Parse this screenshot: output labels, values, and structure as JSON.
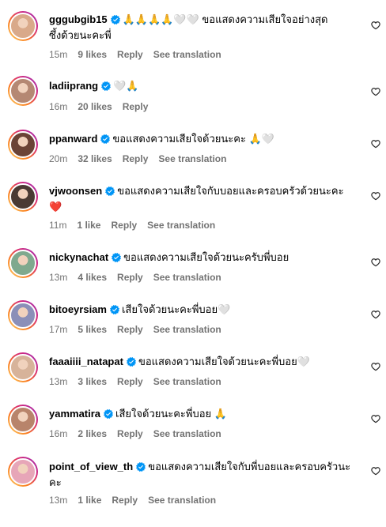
{
  "comments": [
    {
      "username": "gggubgib15",
      "text_line1": "🙏🙏🙏🙏🤍🤍 ขอแสดงความเสียใจอย่างสุด",
      "text_line2": "ซึ้งด้วยนะคะพี่",
      "time": "15m",
      "likes": "9 likes",
      "reply": "Reply",
      "translate": "See translation",
      "avatar_color": "#d9a98a"
    },
    {
      "username": "ladiiprang",
      "text_line1": "🤍🙏",
      "time": "16m",
      "likes": "20 likes",
      "reply": "Reply",
      "avatar_color": "#b58873"
    },
    {
      "username": "ppanward",
      "text_line1": "ขอแสดงความเสียใจด้วยนะคะ 🙏🤍",
      "time": "20m",
      "likes": "32 likes",
      "reply": "Reply",
      "translate": "See translation",
      "avatar_color": "#6b4336"
    },
    {
      "username": "vjwoonsen",
      "text_line1": "ขอแสดงความเสียใจกับบอยและครอบครัวด้วยนะคะ",
      "text_line2": "❤️",
      "time": "11m",
      "likes": "1 like",
      "reply": "Reply",
      "translate": "See translation",
      "avatar_color": "#4a3a33"
    },
    {
      "username": "nickynachat",
      "text_line1": "ขอแสดงความเสียใจด้วยนะครับพี่บอย",
      "time": "13m",
      "likes": "4 likes",
      "reply": "Reply",
      "translate": "See translation",
      "avatar_color": "#7fa98e"
    },
    {
      "username": "bitoeyrsiam",
      "text_line1": "เสียใจด้วยนะคะพี่บอย🤍",
      "time": "17m",
      "likes": "5 likes",
      "reply": "Reply",
      "translate": "See translation",
      "avatar_color": "#8b8fb8"
    },
    {
      "username": "faaaiiii_natapat",
      "text_line1": "ขอแสดงความเสียใจด้วยนะคะพี่บอย🤍",
      "time": "13m",
      "likes": "3 likes",
      "reply": "Reply",
      "translate": "See translation",
      "avatar_color": "#d7b39a"
    },
    {
      "username": "yammatira",
      "text_line1": "เสียใจด้วยนะคะพี่บอย 🙏",
      "time": "16m",
      "likes": "2 likes",
      "reply": "Reply",
      "translate": "See translation",
      "avatar_color": "#b8846b"
    },
    {
      "username": "point_of_view_th",
      "text_line1": "ขอแสดงความเสียใจกับพี่บอยและครอบครัวนะ",
      "text_line2": "คะ",
      "time": "13m",
      "likes": "1 like",
      "reply": "Reply",
      "translate": "See translation",
      "avatar_color": "#e7a6b8"
    }
  ],
  "colors": {
    "verified": "#0095f6",
    "meta": "#737373",
    "heart_red": "#e8213f"
  },
  "icons": {
    "verified": "verified-badge-icon",
    "like": "heart-outline-icon"
  }
}
